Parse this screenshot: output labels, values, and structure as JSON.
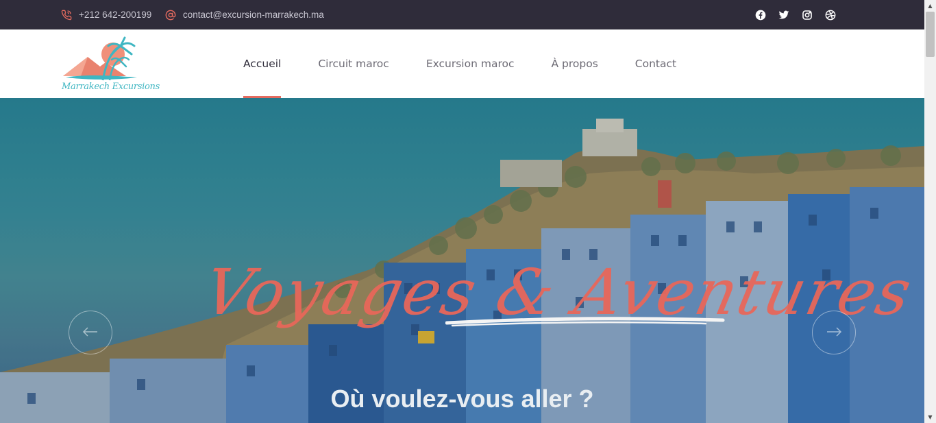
{
  "topbar": {
    "phone": "+212 642-200199",
    "email": "contact@excursion-marrakech.ma",
    "phone_icon": "phone-icon",
    "email_icon": "at-sign-icon",
    "socials": [
      "facebook-icon",
      "twitter-icon",
      "instagram-icon",
      "dribbble-icon"
    ]
  },
  "header": {
    "logo_text": "Marrakech Excursions",
    "nav": [
      {
        "label": "Accueil",
        "active": true
      },
      {
        "label": "Circuit maroc",
        "active": false
      },
      {
        "label": "Excursion maroc",
        "active": false
      },
      {
        "label": "À propos",
        "active": false
      },
      {
        "label": "Contact",
        "active": false
      }
    ]
  },
  "hero": {
    "script_title": "Voyages & Aventures",
    "subtitle": "Où voulez-vous aller ?",
    "prev_icon": "arrow-left-icon",
    "next_icon": "arrow-right-icon"
  },
  "colors": {
    "accent": "#e46b5f",
    "topbar_bg": "#2f2c3a",
    "logo_teal": "#3fb6c2",
    "logo_sun": "#f0907a"
  }
}
